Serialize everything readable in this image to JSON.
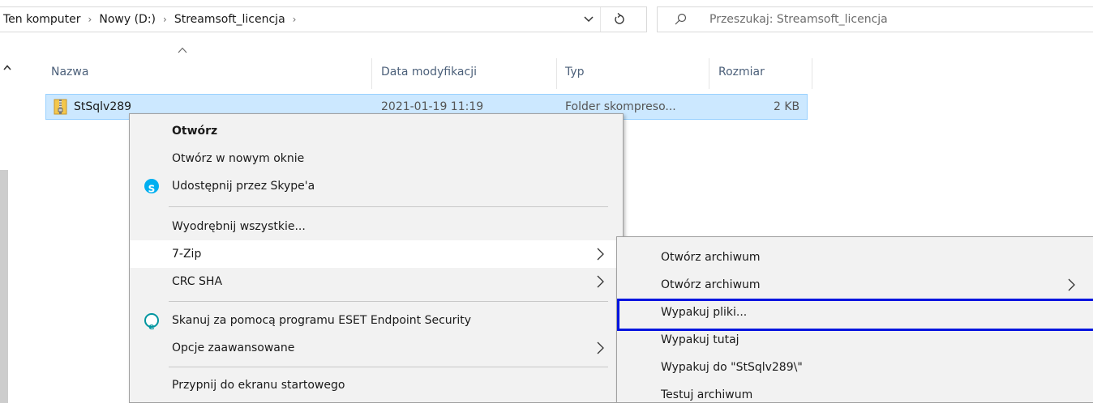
{
  "address_bar": {
    "crumbs": [
      "Ten komputer",
      "Nowy (D:)",
      "Streamsoft_licencja"
    ],
    "separator": "›"
  },
  "search": {
    "placeholder": "Przeszukaj: Streamsoft_licencja"
  },
  "columns": {
    "name": "Nazwa",
    "modified": "Data modyfikacji",
    "type": "Typ",
    "size": "Rozmiar"
  },
  "file": {
    "name": "StSqlv289",
    "modified": "2021-01-19 11:19",
    "type": "Folder skompreso...",
    "size": "2 KB"
  },
  "context_menu": {
    "items": [
      {
        "label": "Otwórz"
      },
      {
        "label": "Otwórz w nowym oknie"
      },
      {
        "label": "Udostępnij przez Skype'a",
        "icon": "skype-icon"
      },
      {
        "label": "Wyodrębnij wszystkie..."
      },
      {
        "label": "7-Zip",
        "submenu": true
      },
      {
        "label": "CRC SHA",
        "submenu": true
      },
      {
        "label": "Skanuj za pomocą programu ESET Endpoint Security",
        "icon": "eset-icon"
      },
      {
        "label": "Opcje zaawansowane",
        "submenu": true
      },
      {
        "label": "Przypnij do ekranu startowego"
      }
    ]
  },
  "submenu_7zip": {
    "items": [
      {
        "label": "Otwórz archiwum"
      },
      {
        "label": "Otwórz archiwum",
        "submenu": true
      },
      {
        "label": "Wypakuj pliki..."
      },
      {
        "label": "Wypakuj tutaj"
      },
      {
        "label": "Wypakuj do \"StSqlv289\\\""
      },
      {
        "label": "Testuj archiwum"
      }
    ]
  },
  "colors": {
    "selection_bg": "#cce8ff",
    "selection_border": "#99d1ff",
    "focus_outline": "#0015e0",
    "skype_blue": "#00aff0",
    "eset_teal": "#0096a0"
  }
}
